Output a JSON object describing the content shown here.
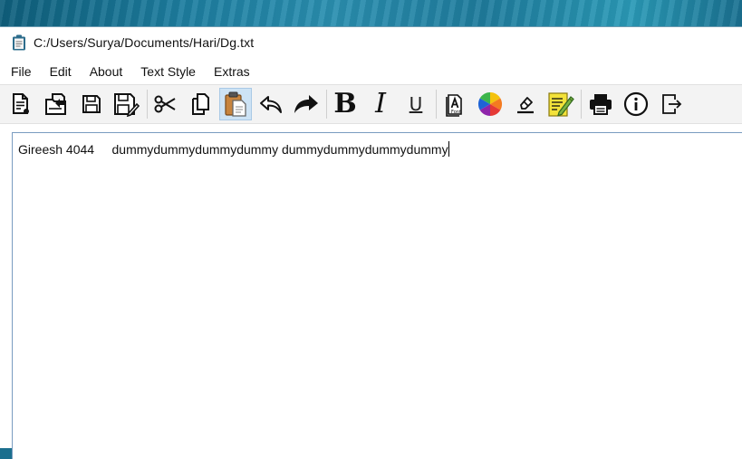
{
  "window": {
    "title": "C:/Users/Surya/Documents/Hari/Dg.txt"
  },
  "menu": {
    "items": [
      "File",
      "Edit",
      "About",
      "Text Style",
      "Extras"
    ]
  },
  "toolbar": {
    "buttons": [
      {
        "icon": "new-document-icon"
      },
      {
        "icon": "open-file-icon"
      },
      {
        "icon": "save-icon"
      },
      {
        "icon": "save-as-icon"
      },
      {
        "icon": "cut-icon"
      },
      {
        "icon": "copy-icon"
      },
      {
        "icon": "paste-icon",
        "active": true
      },
      {
        "icon": "undo-icon"
      },
      {
        "icon": "redo-icon"
      },
      {
        "icon": "bold-icon",
        "glyph": "B"
      },
      {
        "icon": "italic-icon",
        "glyph": "I"
      },
      {
        "icon": "underline-icon",
        "glyph": "U"
      },
      {
        "icon": "font-icon",
        "label": "Font"
      },
      {
        "icon": "color-wheel-icon"
      },
      {
        "icon": "highlight-icon"
      },
      {
        "icon": "notepad-edit-icon"
      },
      {
        "icon": "print-icon"
      },
      {
        "icon": "info-icon"
      },
      {
        "icon": "exit-icon"
      }
    ]
  },
  "editor": {
    "content": "Gireesh 4044     dummydummydummydummy dummydummydummydummy"
  },
  "colors": {
    "toolbar_bg": "#f3f3f3",
    "active_button": "#cde3f5",
    "editor_border": "#7a9cc0",
    "highlight_yellow": "#f3e23a"
  }
}
